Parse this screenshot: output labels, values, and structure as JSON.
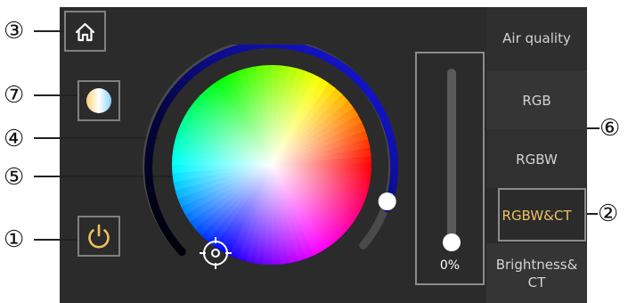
{
  "callouts": {
    "c1": "①",
    "c2": "②",
    "c3": "③",
    "c4": "④",
    "c5": "⑤",
    "c6": "⑥",
    "c7": "⑦"
  },
  "icons": {
    "home": "home-icon",
    "color_mode": "color-mode-icon",
    "power": "power-icon",
    "picker": "crosshair-icon"
  },
  "tabs": [
    {
      "label": "Air quality"
    },
    {
      "label": "RGB"
    },
    {
      "label": "RGBW"
    },
    {
      "label": "RGBW&CT",
      "selected": true
    },
    {
      "label": "Brightness&CT"
    }
  ],
  "brightness": {
    "value_label": "0%",
    "level": 0
  },
  "saturation_ring": {
    "level": 0.88
  },
  "colors": {
    "background": "#2b2b2b",
    "accent": "#f0c060",
    "ring_blue": "#1818e0",
    "text": "#d3d3d3"
  }
}
